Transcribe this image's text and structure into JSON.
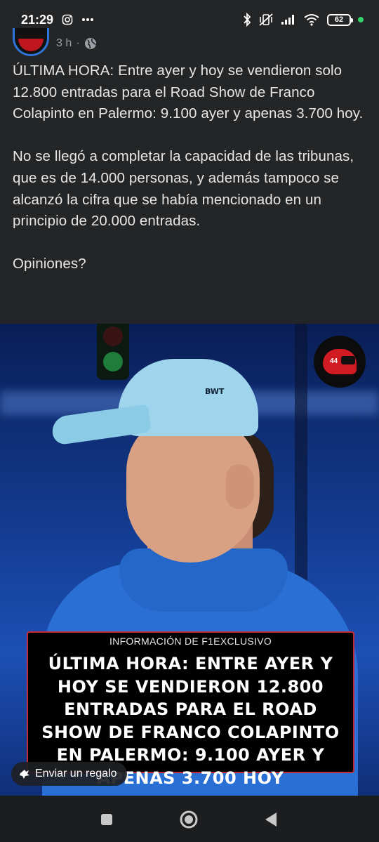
{
  "status_bar": {
    "time": "21:29",
    "battery": "62",
    "icons": [
      "instagram-icon",
      "more-icon",
      "bluetooth-icon",
      "mute-vibrate-icon",
      "signal-icon",
      "wifi-icon",
      "battery-icon"
    ]
  },
  "post": {
    "time_ago": "3 h",
    "separator": "·",
    "paragraphs": [
      "ÚLTIMA HORA: Entre ayer y hoy se vendieron solo 12.800 entradas para el Road Show de Franco Colapinto en Palermo: 9.100 ayer y apenas 3.700 hoy.",
      "No se llegó a completar la capacidad de las tribunas, que es de 14.000 personas, y además tampoco se alcanzó la cifra que se había mencionado en un principio de 20.000 entradas.",
      "Opiniones?"
    ]
  },
  "image": {
    "channel_logo_number": "44",
    "cap_logo": "BWT",
    "banner_source": "INFORMACIÓN DE F1EXCLUSIVO",
    "banner_title": "ÚLTIMA HORA: ENTRE AYER Y HOY SE VENDIERON 12.800 ENTRADAS PARA EL ROAD SHOW DE FRANCO COLAPINTO EN PALERMO: 9.100 AYER Y APENAS 3.700 HOY"
  },
  "gift_button": {
    "label": "Enviar un regalo"
  },
  "colors": {
    "background": "#242526",
    "banner_border": "#c42b3a",
    "avatar_ring": "#2f74d8"
  }
}
